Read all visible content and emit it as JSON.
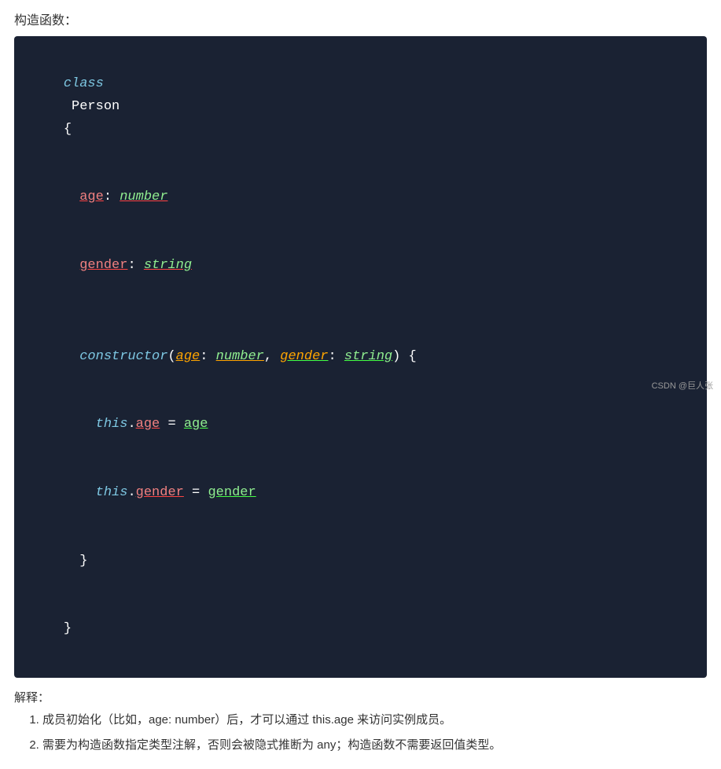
{
  "header": {
    "title": "构造函数："
  },
  "code": {
    "lines": [
      "class Person {",
      "  age: number",
      "  gender: string",
      "",
      "  constructor(age: number, gender: string) {",
      "    this.age = age",
      "    this.gender = gender",
      "  }",
      "}"
    ]
  },
  "explanation": {
    "label": "解释：",
    "items": [
      "成员初始化（比如，age: number）后，才可以通过 this.age 来访问实例成员。",
      "需要为构造函数指定类型注解，否则会被隐式推断为 any；构造函数不需要返回值类型。"
    ]
  },
  "watermark": "CSDN @巨人张"
}
